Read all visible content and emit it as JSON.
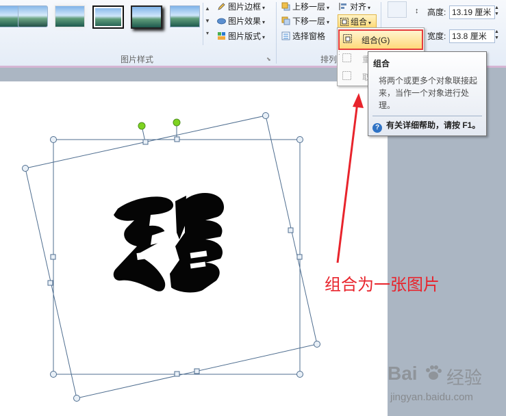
{
  "ribbon": {
    "picture_styles_group_label": "图片样式",
    "arrange_group_label": "排列",
    "picture_border": "图片边框",
    "picture_effects": "图片效果",
    "picture_layout": "图片版式",
    "bring_forward": "上移一层",
    "send_backward": "下移一层",
    "selection_pane": "选择窗格",
    "align": "对齐",
    "group": "组合",
    "height_label": "高度:",
    "height_value": "13.19 厘米",
    "width_label": "宽度:",
    "width_value": "13.8 厘米"
  },
  "dropdown": {
    "group_item": "组合(G)",
    "regroup_item": "重",
    "ungroup_item": "取"
  },
  "tooltip": {
    "title": "组合",
    "body": "将两个或更多个对象联接起来，当作一个对象进行处理。",
    "help": "有关详细帮助，请按 F1。"
  },
  "annotation": "组合为一张图片",
  "watermark": {
    "brand": "Bai",
    "brand2": "经验",
    "url": "jingyan.baidu.com"
  },
  "colors": {
    "accent_red": "#e8242c",
    "highlight_yellow": "#ffd97a",
    "selection_line": "#4e6d8f",
    "rotate_handle": "#7ed321"
  }
}
